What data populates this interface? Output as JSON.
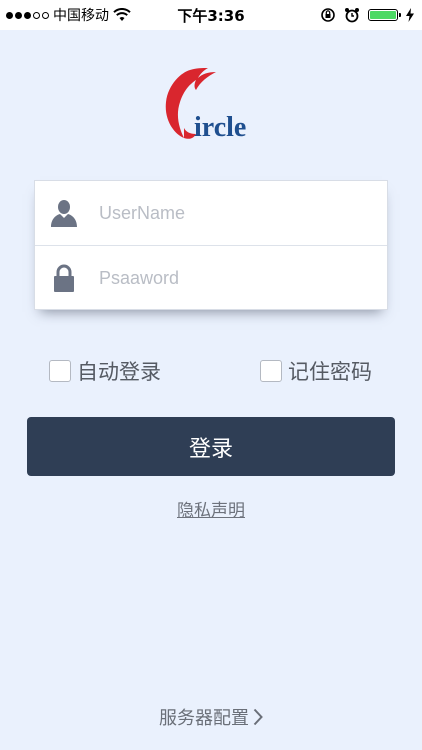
{
  "status_bar": {
    "carrier": "中国移动",
    "time": "下午3:36",
    "battery_color": "#4cd964"
  },
  "logo": {
    "text": "ircle",
    "brand_red": "#d9262e",
    "brand_blue": "#1f4f8f"
  },
  "form": {
    "username_placeholder": "UserName",
    "password_placeholder": "Psaaword",
    "user_icon": "user-icon",
    "lock_icon": "lock-icon"
  },
  "options": {
    "auto_login_label": "自动登录",
    "remember_password_label": "记住密码"
  },
  "actions": {
    "login_label": "登录",
    "privacy_label": "隐私声明",
    "server_config_label": "服务器配置",
    "button_color": "#2f3e55"
  }
}
